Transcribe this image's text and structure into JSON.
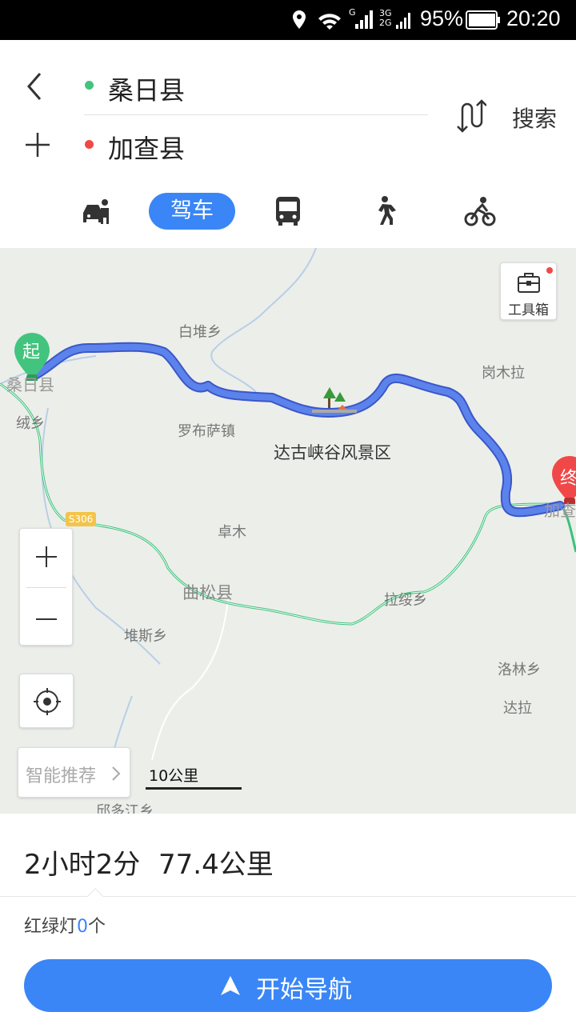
{
  "status_bar": {
    "signal_g": "G",
    "network": "3G 2G",
    "battery": "95%",
    "time": "20:20"
  },
  "route": {
    "origin": "桑日县",
    "destination": "加查县",
    "search_label": "搜索",
    "origin_color": "#43c47e",
    "destination_color": "#f04848"
  },
  "modes": [
    {
      "name": "taxi",
      "icon": "taxi-icon"
    },
    {
      "name": "drive",
      "label": "驾车",
      "selected": true
    },
    {
      "name": "bus",
      "icon": "bus-icon"
    },
    {
      "name": "walk",
      "icon": "walk-icon"
    },
    {
      "name": "bike",
      "icon": "bike-icon"
    }
  ],
  "map": {
    "toolbox_label": "工具箱",
    "start_marker": "起",
    "end_marker": "终",
    "road_badge": "S306",
    "scale_label": "10公里",
    "smart_recommend": "智能推荐",
    "poi_label": "达古峡谷风景区",
    "places": {
      "baidui": "白堆乡",
      "sangri": "桑日县",
      "lvxiang": "绒乡",
      "luobusa": "罗布萨镇",
      "gangmula": "岗木拉",
      "jiacha": "加查",
      "zhuomu": "卓木",
      "qusong": "曲松县",
      "lasui": "拉绥乡",
      "duisi": "堆斯乡",
      "luolin": "洛林乡",
      "dala": "达拉",
      "yiduojiang": "邱多江乡"
    }
  },
  "summary": {
    "duration": "2小时2分",
    "distance": "77.4公里",
    "traffic_prefix": "红绿灯",
    "traffic_count": "0",
    "traffic_suffix": "个"
  },
  "nav_button": {
    "label": "开始导航"
  },
  "colors": {
    "accent": "#3a86f6",
    "route": "#4a6ee0",
    "green_road": "#39c27a"
  }
}
